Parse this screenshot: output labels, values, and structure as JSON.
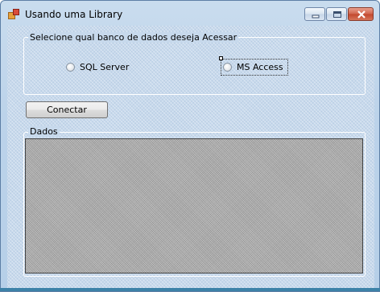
{
  "window": {
    "title": "Usando uma Library"
  },
  "window_controls": [
    {
      "name": "minimize-button",
      "icon": "minimize-icon"
    },
    {
      "name": "maximize-button",
      "icon": "maximize-icon"
    },
    {
      "name": "close-button",
      "icon": "close-icon"
    }
  ],
  "select_group": {
    "label": "Selecione qual banco de dados deseja Acessar",
    "options": [
      {
        "label": "SQL Server",
        "checked": false
      },
      {
        "label": "MS Access",
        "checked": false,
        "focused": true
      }
    ]
  },
  "connect_button": {
    "label": "Conectar"
  },
  "data_group": {
    "label": "Dados"
  },
  "colors": {
    "window_background": "#c7d9ec",
    "grid_background": "#a8a8a8",
    "close_button": "#c2472c"
  }
}
